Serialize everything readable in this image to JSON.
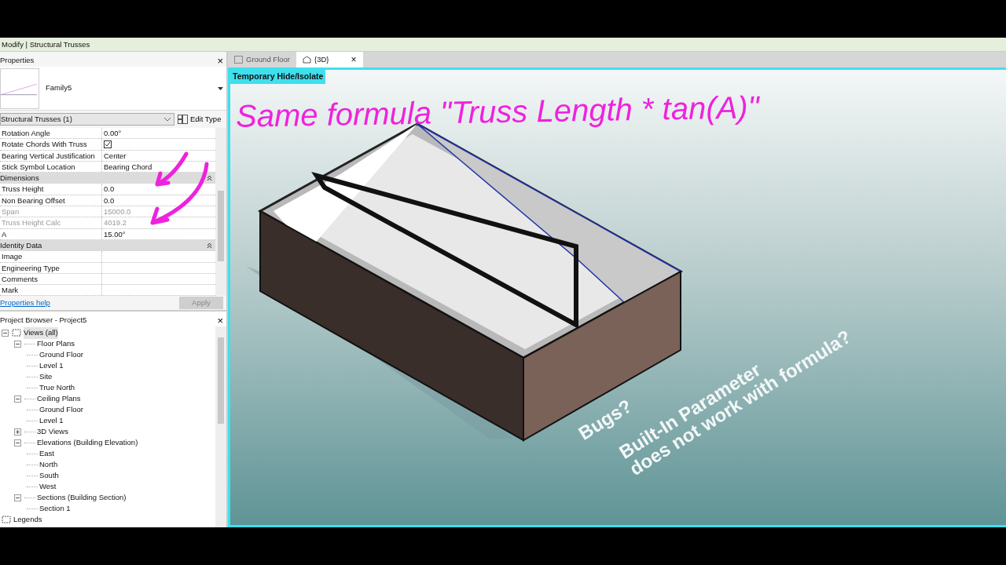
{
  "context_bar": {
    "title": "Modify | Structural Trusses"
  },
  "properties": {
    "title": "Properties",
    "close": "×",
    "family": "Family5",
    "type_selector": "Structural Trusses (1)",
    "edit_type": "Edit Type",
    "rows": [
      {
        "kind": "text",
        "label": "Rotation Angle",
        "value": "0.00°",
        "disabled": false
      },
      {
        "kind": "checkbox",
        "label": "Rotate Chords With Truss",
        "checked": true,
        "disabled": false
      },
      {
        "kind": "text",
        "label": "Bearing Vertical Justification",
        "value": "Center",
        "disabled": false
      },
      {
        "kind": "text",
        "label": "Stick Symbol Location",
        "value": "Bearing Chord",
        "disabled": false
      },
      {
        "kind": "group",
        "label": "Dimensions",
        "expanded": true
      },
      {
        "kind": "text",
        "label": "Truss Height",
        "value": "0.0",
        "disabled": false
      },
      {
        "kind": "text",
        "label": "Non Bearing Offset",
        "value": "0.0",
        "disabled": false
      },
      {
        "kind": "text",
        "label": "Span",
        "value": "15000.0",
        "disabled": true
      },
      {
        "kind": "text",
        "label": "Truss Height Calc",
        "value": "4019.2",
        "disabled": true
      },
      {
        "kind": "text",
        "label": "A",
        "value": "15.00°",
        "disabled": false
      },
      {
        "kind": "group",
        "label": "Identity Data",
        "expanded": true
      },
      {
        "kind": "text",
        "label": "Image",
        "value": "",
        "disabled": false
      },
      {
        "kind": "text",
        "label": "Engineering Type",
        "value": "",
        "disabled": false
      },
      {
        "kind": "text",
        "label": "Comments",
        "value": "",
        "disabled": false
      },
      {
        "kind": "text",
        "label": "Mark",
        "value": "",
        "disabled": false
      }
    ],
    "help_link": "Properties help",
    "apply": "Apply"
  },
  "project_browser": {
    "title": "Project Browser - Project5",
    "close": "×",
    "tree": [
      {
        "label": "Views (all)",
        "selected": true,
        "expanded": true,
        "children": [
          {
            "label": "Floor Plans",
            "selected": false,
            "expanded": true,
            "children": [
              {
                "label": "Ground Floor",
                "selected": false
              },
              {
                "label": "Level 1",
                "selected": false
              },
              {
                "label": "Site",
                "selected": false
              },
              {
                "label": "True North",
                "selected": false
              }
            ]
          },
          {
            "label": "Ceiling Plans",
            "selected": false,
            "expanded": true,
            "children": [
              {
                "label": "Ground Floor",
                "selected": false
              },
              {
                "label": "Level 1",
                "selected": false
              }
            ]
          },
          {
            "label": "3D Views",
            "selected": false,
            "expanded": false
          },
          {
            "label": "Elevations (Building Elevation)",
            "selected": false,
            "expanded": true,
            "children": [
              {
                "label": "East",
                "selected": false
              },
              {
                "label": "North",
                "selected": false
              },
              {
                "label": "South",
                "selected": false
              },
              {
                "label": "West",
                "selected": false
              }
            ]
          },
          {
            "label": "Sections (Building Section)",
            "selected": false,
            "expanded": true,
            "children": [
              {
                "label": "Section 1",
                "selected": false
              }
            ]
          }
        ]
      },
      {
        "label": "Legends",
        "selected": false
      }
    ]
  },
  "view_tabs": [
    {
      "label": "Ground Floor",
      "selected": false
    },
    {
      "label": "{3D}",
      "selected": true,
      "close": "×"
    }
  ],
  "view_banner": "Temporary Hide/Isolate",
  "annotations": {
    "heading": "Same formula \"Truss Length * tan(A)\"",
    "question": "Bugs?",
    "note_lines": [
      "Built-In Parameter",
      "does not work with formula?"
    ]
  }
}
